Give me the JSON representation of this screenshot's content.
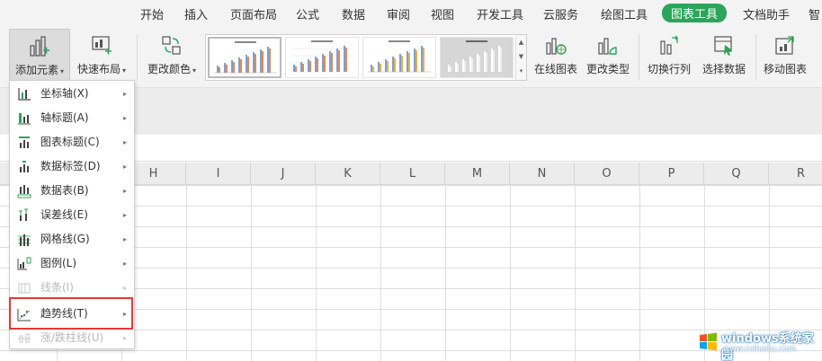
{
  "tabs": [
    {
      "label": "开始"
    },
    {
      "label": "插入"
    },
    {
      "label": "页面布局"
    },
    {
      "label": "公式"
    },
    {
      "label": "数据"
    },
    {
      "label": "审阅"
    },
    {
      "label": "视图"
    },
    {
      "label": "开发工具"
    },
    {
      "label": "云服务"
    },
    {
      "label": "绘图工具"
    },
    {
      "label": "图表工具"
    },
    {
      "label": "文档助手"
    },
    {
      "label": "智"
    }
  ],
  "ribbon": {
    "add_element": "添加元素",
    "quick_layout": "快速布局",
    "change_color": "更改颜色",
    "online_chart": "在线图表",
    "change_type": "更改类型",
    "switch_row_col": "切换行列",
    "select_data": "选择数据",
    "move_chart": "移动图表"
  },
  "columns": [
    "H",
    "I",
    "J",
    "K",
    "L",
    "M",
    "N",
    "O",
    "P",
    "Q",
    "R"
  ],
  "menu": {
    "items": [
      {
        "label": "坐标轴(X)",
        "icon": "axis-icon",
        "disabled": false
      },
      {
        "label": "轴标题(A)",
        "icon": "axis-title-icon",
        "disabled": false
      },
      {
        "label": "图表标题(C)",
        "icon": "chart-title-icon",
        "disabled": false
      },
      {
        "label": "数据标签(D)",
        "icon": "data-label-icon",
        "disabled": false
      },
      {
        "label": "数据表(B)",
        "icon": "data-table-icon",
        "disabled": false
      },
      {
        "label": "误差线(E)",
        "icon": "error-bar-icon",
        "disabled": false
      },
      {
        "label": "网格线(G)",
        "icon": "gridline-icon",
        "disabled": false
      },
      {
        "label": "图例(L)",
        "icon": "legend-icon",
        "disabled": false
      },
      {
        "label": "线条(I)",
        "icon": "line-icon",
        "disabled": true
      },
      {
        "label": "趋势线(T)",
        "icon": "trendline-icon",
        "disabled": false
      },
      {
        "label": "涨/跌柱线(U)",
        "icon": "updown-bar-icon",
        "disabled": true
      }
    ]
  },
  "watermark": {
    "title": "windows系统家园",
    "subtitle": "www.ruihaitu.com"
  },
  "colors": {
    "accent": "#2aa55a",
    "highlight_border": "#e53935"
  }
}
